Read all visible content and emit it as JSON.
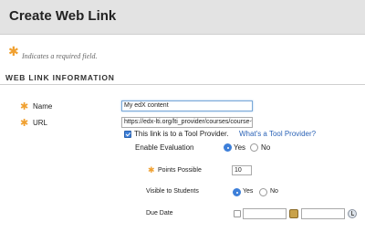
{
  "header": {
    "title": "Create Web Link"
  },
  "required_note": "Indicates a required field.",
  "section": {
    "title": "WEB LINK INFORMATION"
  },
  "form": {
    "name": {
      "label": "Name",
      "value": "My edX content"
    },
    "url": {
      "label": "URL",
      "value": "https://edx-lti.org/lti_provider/courses/course-v"
    },
    "tool_provider": {
      "checked": true,
      "label": "This link is to a Tool Provider.",
      "help_link": "What's a Tool Provider?"
    },
    "enable_evaluation": {
      "label": "Enable Evaluation",
      "yes": "Yes",
      "no": "No",
      "selected": "Yes"
    },
    "points_possible": {
      "label": "Points Possible",
      "value": "10"
    },
    "visible_to_students": {
      "label": "Visible to Students",
      "yes": "Yes",
      "no": "No",
      "selected": "Yes"
    },
    "due_date": {
      "label": "Due Date",
      "checked": false,
      "date_value": "",
      "time_value": ""
    }
  },
  "colors": {
    "required_star": "#f0a030",
    "link": "#2a62b6",
    "accent": "#3d7fd9",
    "header_bg": "#e3e3e3"
  },
  "icons": [
    "required-asterisk-icon",
    "calendar-icon",
    "clock-icon"
  ]
}
